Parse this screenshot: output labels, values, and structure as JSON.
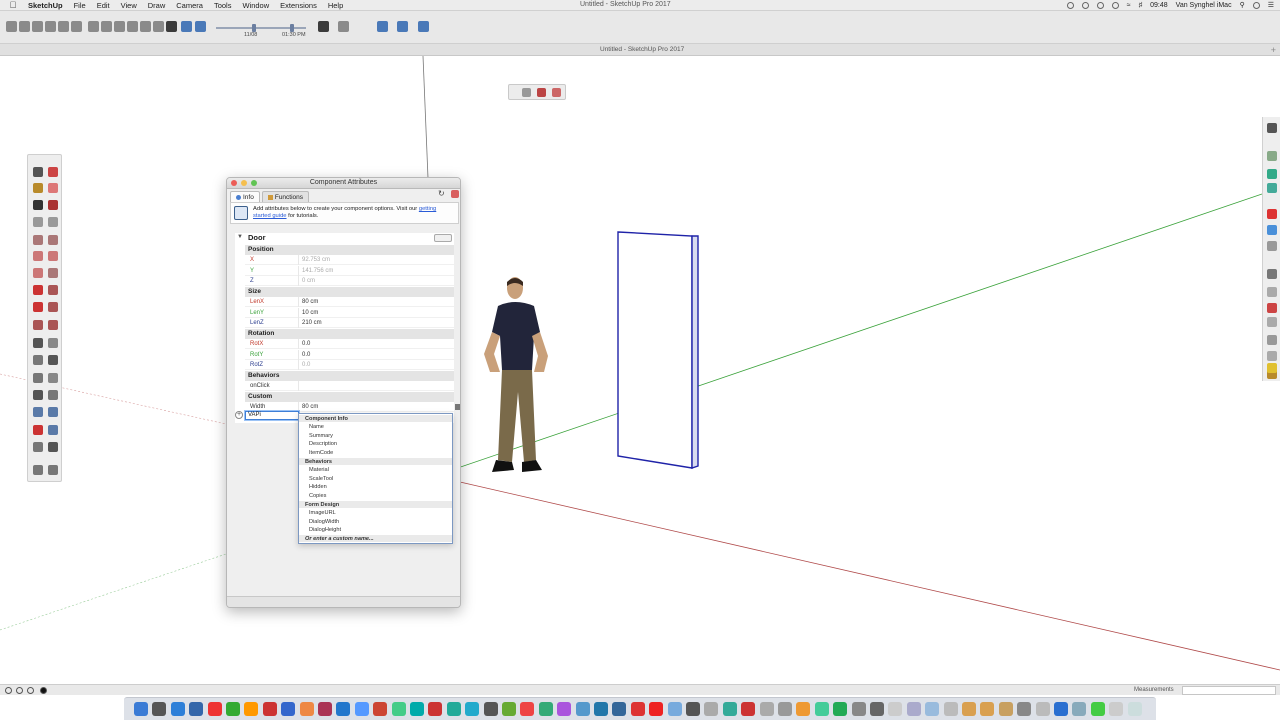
{
  "menubar": {
    "app_name": "SketchUp",
    "menus": [
      "SketchUp",
      "File",
      "Edit",
      "View",
      "Draw",
      "Camera",
      "Tools",
      "Window",
      "Extensions",
      "Help"
    ],
    "window_title": "Untitled - SketchUp Pro 2017",
    "clock": "09:48",
    "user": "Van Synghel iMac"
  },
  "toolbar": {
    "shadow_date": "11/08",
    "shadow_time": "01:30 PM"
  },
  "document": {
    "title": "Untitled - SketchUp Pro 2017"
  },
  "dialog": {
    "title": "Component Attributes",
    "tabs": [
      {
        "label": "Info",
        "active": true
      },
      {
        "label": "Functions",
        "active": false
      }
    ],
    "info_text_before": "Add attributes below to create your component options. Visit our",
    "info_link": "getting started guide",
    "info_text_after": "for tutorials.",
    "component_name": "Door",
    "sections": {
      "position": "Position",
      "size": "Size",
      "rotation": "Rotation",
      "behaviors": "Behaviors",
      "custom": "Custom"
    },
    "rows": {
      "x": {
        "label": "X",
        "value": "92.753 cm"
      },
      "y": {
        "label": "Y",
        "value": "141.756 cm"
      },
      "z": {
        "label": "Z",
        "value": "0 cm"
      },
      "lenx": {
        "label": "LenX",
        "value": "80 cm"
      },
      "leny": {
        "label": "LenY",
        "value": "10 cm"
      },
      "lenz": {
        "label": "LenZ",
        "value": "210 cm"
      },
      "rotx": {
        "label": "RotX",
        "value": "0.0"
      },
      "roty": {
        "label": "RotY",
        "value": "0.0"
      },
      "rotz": {
        "label": "RotZ",
        "value": "0.0"
      },
      "onclick": {
        "label": "onClick",
        "value": ""
      },
      "width": {
        "label": "Width",
        "value": "80 cm"
      }
    },
    "custom_input_value": "VAPi"
  },
  "dropdown": {
    "groups": [
      {
        "title": "Component Info",
        "items": [
          "Name",
          "Summary",
          "Description",
          "ItemCode"
        ]
      },
      {
        "title": "Behaviors",
        "items": [
          "Material",
          "ScaleTool",
          "Hidden",
          "Copies"
        ]
      },
      {
        "title": "Form Design",
        "items": [
          "ImageURL",
          "DialogWidth",
          "DialogHeight"
        ]
      }
    ],
    "footer": "Or enter a custom name..."
  },
  "statusbar": {
    "measurements_label": "Measurements"
  },
  "colors": {
    "axis_red": "#b04a4a",
    "axis_green": "#3aa23a",
    "axis_blue": "#2c3e8f",
    "door_edge": "#1f23a8",
    "link": "#2a5bd7"
  }
}
